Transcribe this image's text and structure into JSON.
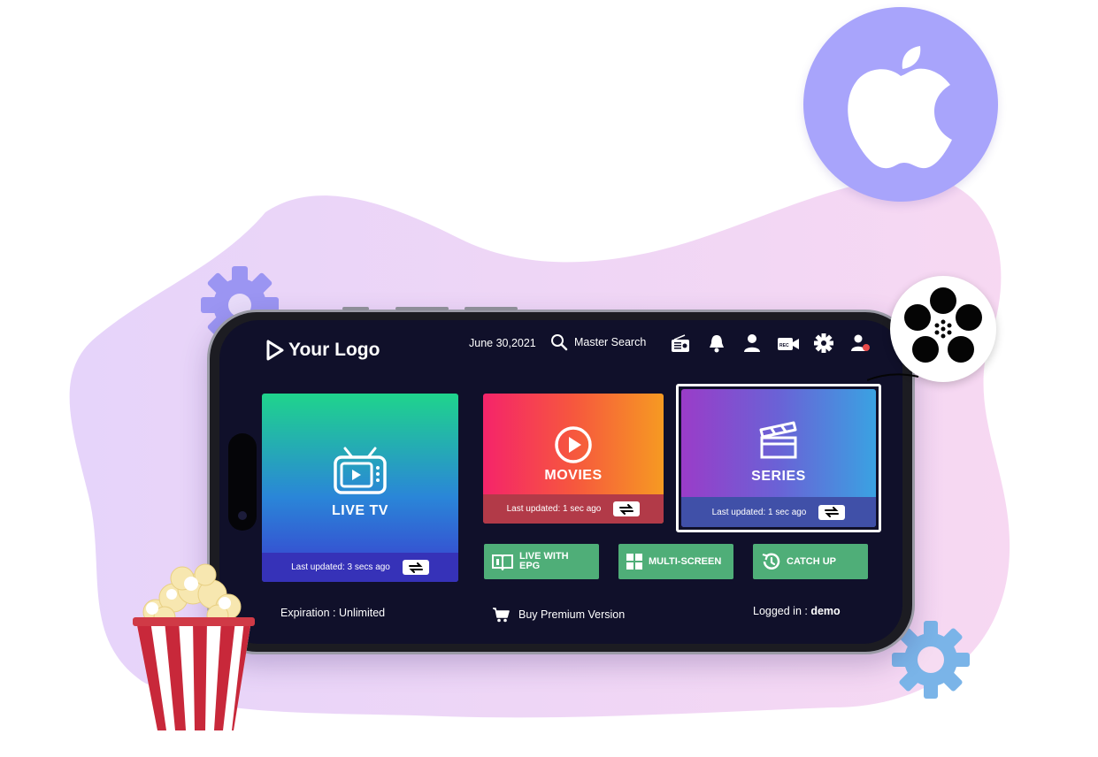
{
  "header": {
    "logo_text": "Your Logo",
    "date": "June 30,2021",
    "search_label": "Master Search",
    "icons": [
      "radio-icon",
      "bell-icon",
      "user-icon",
      "record-icon",
      "gear-icon",
      "switch-user-icon"
    ]
  },
  "tiles": {
    "live_tv": {
      "label": "LIVE TV",
      "updated": "Last updated: 3 secs ago"
    },
    "movies": {
      "label": "MOVIES",
      "updated": "Last updated: 1 sec ago"
    },
    "series": {
      "label": "SERIES",
      "updated": "Last updated: 1 sec ago"
    }
  },
  "buttons": {
    "live_epg_line1": "LIVE WITH",
    "live_epg_line2": "EPG",
    "multi_screen": "MULTI-SCREEN",
    "catch_up": "CATCH UP"
  },
  "footer": {
    "expiration": "Expiration : Unlimited",
    "buy": "Buy Premium Version",
    "logged_prefix": "Logged in : ",
    "logged_user": "demo"
  },
  "colors": {
    "apple_circle": "#a8a4fb",
    "blob_pink": "#f5d8f4",
    "blob_lavender": "#e2d2f8",
    "gear_purple": "#9b95f2",
    "gear_blue": "#7ab4e8",
    "button_green": "#4fae78"
  }
}
